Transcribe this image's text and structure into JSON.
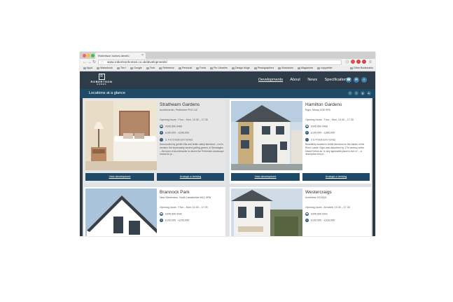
{
  "browser": {
    "tab_title": "Robertson homes develo",
    "url": "www.robertsonhomes.co.uk/developments/",
    "bookmarks": [
      "Apps",
      "Makerbook",
      "The t",
      "Google",
      "Tech",
      "Reference",
      "Personal",
      "Fonts",
      "Pic Libraries",
      "Design blogs",
      "Photographers",
      "Illustrators",
      "Magazines",
      "copywriter"
    ],
    "other_bookmarks": "Other Bookmarks",
    "colors": {
      "close": "#fc615d",
      "minimize": "#fdbc40",
      "maximize": "#34c84a"
    }
  },
  "site": {
    "logo_name": "ROBERTSON",
    "logo_sub": "HOMES",
    "logo_mark": "R",
    "nav": [
      "Developments",
      "About",
      "News",
      "Specifications"
    ],
    "page_title": "Locations at a glance",
    "colors": {
      "header": "#2e3c49",
      "titlebar": "#1f4a67",
      "button": "#1f4a67",
      "accent": "#3c7fa6"
    }
  },
  "cards": [
    {
      "title": "Strathearn Gardens",
      "address": "Auchterarder, Perthshire PH3 1JZ",
      "hours": "Opening hours : Thur – Mon, 10.30 – 17.30",
      "phone": "0345 890 9466",
      "price": "£180,000 – £295,000",
      "bedrooms": "3, 4 & 5 bedroom homes",
      "description": "Surrounded by gentle hills and fertile valley farmland – not to mention the impeccably landed golfing greens of Gleneagles – the town of Auchterarder is where the Perthshire landscape shows its pl...",
      "view_label": "View development",
      "arrange_label": "Arrange a viewing"
    },
    {
      "title": "Hamilton Gardens",
      "address": "Elgin, Moray IV30 5PA",
      "hours": "Opening hours : Thur – Mon, 10.30 – 17.30",
      "phone": "0345 890 9468",
      "price": "£199,995 – £389,995",
      "bedrooms": "3 & 4 bedroom homes",
      "description": "Beautifully located in fertile farmland on the banks of the River Lossie, Elgin was described by 17th century writer Daniel Defoe as \"a very agreeable place to live in\" – a description this pl...",
      "view_label": "View development",
      "arrange_label": "Arrange a viewing"
    },
    {
      "title": "Brannock Park",
      "address": "New Stevenston, North Lanarkshire ML1 5FW",
      "hours": "Opening hours : Thur – Mon, 11.00 – 17.00",
      "phone": "0345 890 9442",
      "price": "£145,995 – £235,995"
    },
    {
      "title": "Westercraigs",
      "address": "Inverness IV3 8QG",
      "hours": "Opening hours : All week, 10.30 – 17.30",
      "phone": "0345 890 9441",
      "price": "£199,995 – £328,995"
    }
  ]
}
